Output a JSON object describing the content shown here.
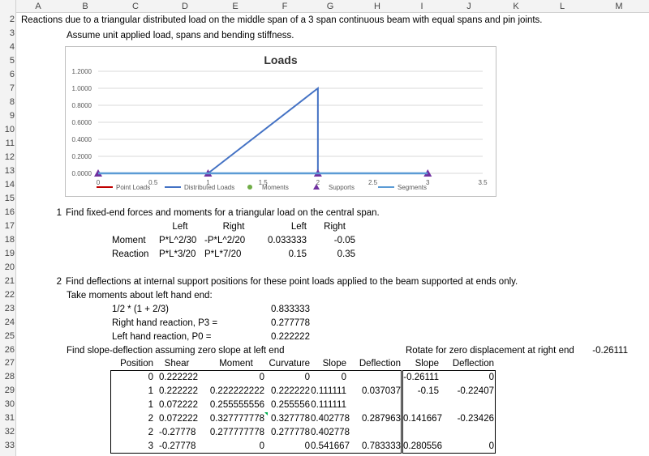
{
  "columns": [
    "A",
    "B",
    "C",
    "D",
    "E",
    "F",
    "G",
    "H",
    "I",
    "J",
    "K",
    "L",
    "M"
  ],
  "rows": [
    "2",
    "3",
    "4",
    "5",
    "6",
    "7",
    "8",
    "9",
    "10",
    "11",
    "12",
    "13",
    "14",
    "15",
    "16",
    "17",
    "18",
    "19",
    "20",
    "21",
    "22",
    "23",
    "24",
    "25",
    "26",
    "27",
    "28",
    "29",
    "30",
    "31",
    "32",
    "33"
  ],
  "title_line": "Reactions due to a triangular distributed load on the middle span of a 3 span continuous beam with equal spans and pin joints.",
  "assume_line": "Assume unit applied load, spans and bending stiffness.",
  "step1": {
    "num": "1",
    "text": "Find fixed-end forces and moments for a triangular load on the central span."
  },
  "fixed_end": {
    "headers": [
      "Left",
      "Right",
      "Left",
      "Right"
    ],
    "rows": [
      {
        "label": "Moment",
        "formula_left": "P*L^2/30",
        "formula_right": "-P*L^2/20",
        "left": "0.033333",
        "right": "-0.05"
      },
      {
        "label": "Reaction",
        "formula_left": "P*L*3/20",
        "formula_right": "P*L*7/20",
        "left": "0.15",
        "right": "0.35"
      }
    ]
  },
  "step2": {
    "num": "2",
    "text": "Find deflections at internal support positions for these point loads applied to the beam supported at ends only."
  },
  "moments_line": "Take moments about left hand end:",
  "calc": [
    {
      "label": "1/2 * (1 + 2/3)",
      "value": "0.833333"
    },
    {
      "label": "Right hand reaction, P3 =",
      "value": "0.277778"
    },
    {
      "label": "Left hand reaction, P0 =",
      "value": "0.222222"
    }
  ],
  "slope_line": "Find slope-deflection assuming zero slope at left end",
  "rotate": {
    "label": "Rotate for zero displacement at right end",
    "value": "-0.26111"
  },
  "table": {
    "headers": [
      "Position",
      "Shear",
      "Moment",
      "Curvature",
      "Slope",
      "Deflection"
    ],
    "headers2": [
      "Slope",
      "Deflection"
    ],
    "rows": [
      [
        "0",
        "0.222222",
        "0",
        "0",
        "0",
        "",
        "-0.26111",
        "0"
      ],
      [
        "1",
        "0.222222",
        "0.222222222",
        "0.222222",
        "0.111111",
        "0.037037",
        "-0.15",
        "-0.22407"
      ],
      [
        "1",
        "0.072222",
        "0.255555556",
        "0.255556",
        "0.111111",
        "",
        "",
        ""
      ],
      [
        "2",
        "0.072222",
        "0.327777778",
        "0.327778",
        "0.402778",
        "0.287963",
        "0.141667",
        "-0.23426"
      ],
      [
        "2",
        "-0.27778",
        "0.277777778",
        "0.277778",
        "0.402778",
        "",
        "",
        ""
      ],
      [
        "3",
        "-0.27778",
        "0",
        "0",
        "0.541667",
        "0.783333",
        "0.280556",
        "0"
      ]
    ]
  },
  "chart_data": {
    "type": "line",
    "title": "Loads",
    "xlim": [
      0,
      3.5
    ],
    "ylim": [
      0,
      1.2
    ],
    "x_ticks": [
      "0",
      "0.5",
      "1",
      "1.5",
      "2",
      "2.5",
      "3",
      "3.5"
    ],
    "y_ticks": [
      "0.0000",
      "0.2000",
      "0.4000",
      "0.6000",
      "0.8000",
      "1.0000",
      "1.2000"
    ],
    "series": [
      {
        "name": "Point Loads",
        "color": "#c00000",
        "x": [],
        "y": []
      },
      {
        "name": "Distributed Loads",
        "color": "#4472c4",
        "x": [
          1,
          2,
          2
        ],
        "y": [
          0,
          1,
          0
        ]
      },
      {
        "name": "Moments",
        "color": "#70ad47",
        "x": [],
        "y": []
      },
      {
        "name": "Supports",
        "color": "#7030a0",
        "x": [
          0,
          1,
          2,
          3
        ],
        "y": [
          0,
          0,
          0,
          0
        ]
      },
      {
        "name": "Segments",
        "color": "#5b9bd5",
        "x": [
          0,
          3
        ],
        "y": [
          0,
          0
        ]
      }
    ],
    "legend_position": "bottom"
  }
}
